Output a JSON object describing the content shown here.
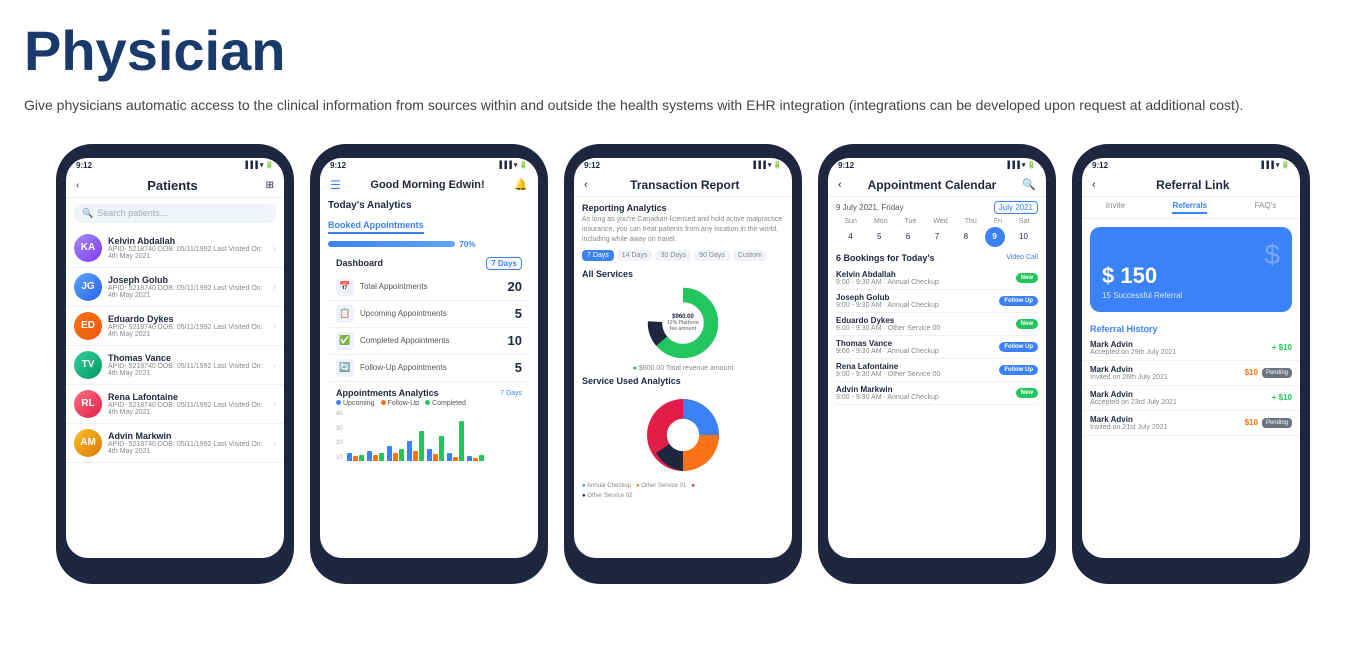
{
  "heading": "Physician",
  "subtitle": "Give physicians automatic access to the clinical information from sources within and outside the health systems with EHR integration (integrations can be developed upon request at additional cost).",
  "phones": {
    "phone1": {
      "status_time": "9:12",
      "title": "Patients",
      "search_placeholder": "Search patients...",
      "patients": [
        {
          "name": "Kelvin Abdallah",
          "details": "APID- 5218740   DOB: 05/11/1992   Last Visited On: 4th May 2021",
          "av": "av1",
          "initials": "KA"
        },
        {
          "name": "Joseph Golub",
          "details": "APID- 5218740   DOB: 05/11/1992   Last Visited On: 4th May 2021",
          "av": "av2",
          "initials": "JG"
        },
        {
          "name": "Eduardo Dykes",
          "details": "APID- 5218740   DOB: 05/11/1992   Last Visited On: 4th May 2021",
          "av": "av3",
          "initials": "ED"
        },
        {
          "name": "Thomas Vance",
          "details": "APID- 5218740   DOB: 05/11/1992   Last Visited On: 4th May 2021",
          "av": "av4",
          "initials": "TV"
        },
        {
          "name": "Rena Lafontaine",
          "details": "APID- 5218740   DOB: 05/11/1992   Last Visited On: 4th May 2021",
          "av": "av5",
          "initials": "RL"
        },
        {
          "name": "Advin Markwin",
          "details": "APID- 5218740   DOB: 05/11/1992   Last Visited On: 4th May 2021",
          "av": "av6",
          "initials": "AM"
        }
      ]
    },
    "phone2": {
      "status_time": "9:12",
      "greeting": "Good Morning Edwin!",
      "analytics_title": "Today's Analytics",
      "booked_tab": "Booked Appointments",
      "booked_pct": "70%",
      "dashboard_title": "Dashboard",
      "days_label": "7 Days",
      "stats": [
        {
          "label": "Total Appointments",
          "value": "20",
          "icon": "📅"
        },
        {
          "label": "Upcoming Appointments",
          "value": "5",
          "icon": "📋"
        },
        {
          "label": "Completed Appointments",
          "value": "10",
          "icon": "✅"
        },
        {
          "label": "Follow-Up Appointments",
          "value": "5",
          "icon": "🔄"
        }
      ],
      "appointments_analytics_title": "Appointments Analytics",
      "appointments_days": "7 Days",
      "legend": [
        "Upcoming",
        "Follow-Up",
        "Completed"
      ]
    },
    "phone3": {
      "status_time": "9:12",
      "title": "Transaction Report",
      "reporting_title": "Reporting Analytics",
      "reporting_desc": "As long as you're Canadian-licensed and hold active malpractice insurance, you can treat patients from any location in the world, including while away on travel.",
      "filter_tabs": [
        "7 Days",
        "14 Days",
        "30 Days",
        "90 Days",
        "Custom"
      ],
      "active_filter": "7 Days",
      "all_services_title": "All Services",
      "service_analytics_title": "Service Used Analytics",
      "donut_values": [
        {
          "label": "$960.00\n12% Platform fee amount",
          "pct": 12,
          "color": "#1e2640"
        },
        {
          "label": "$600.00\nTotal revenue amount",
          "pct": 88,
          "color": "#22c55e"
        }
      ]
    },
    "phone4": {
      "status_time": "9:12",
      "title": "Appointment Calendar",
      "date_label": "9 July 2021, Friday",
      "month_label": "July 2021",
      "day_headers": [
        "Sun",
        "Mon",
        "Tue",
        "Wed",
        "Thu",
        "Fri",
        "Sat"
      ],
      "days": [
        "4",
        "5",
        "6",
        "7",
        "8",
        "9",
        "10"
      ],
      "active_day": "9",
      "bookings_title": "6 Bookings for Today's",
      "video_call": "Video Call",
      "bookings": [
        {
          "name": "Kelvin Abdallah",
          "time": "9:00 - 9:30 AM · Annual Checkup",
          "badge": "new",
          "badge_label": "New"
        },
        {
          "name": "Joseph Golub",
          "time": "9:00 - 9:30 AM · Annual Checkup",
          "badge": "followup",
          "badge_label": "Follow Up"
        },
        {
          "name": "Eduardo Dykes",
          "time": "9:00 - 9:30 AM · Other Service 00",
          "badge": "new",
          "badge_label": "New"
        },
        {
          "name": "Thomas Vance",
          "time": "9:00 - 9:30 AM · Annual Checkup",
          "badge": "followup",
          "badge_label": "Follow Up"
        },
        {
          "name": "Rena Lafontaine",
          "time": "9:00 - 9:30 AM · Other Service 00",
          "badge": "followup",
          "badge_label": "Follow Up"
        },
        {
          "name": "Advin Markwin",
          "time": "9:00 - 9:30 AM · Annual Checkup",
          "badge": "new",
          "badge_label": "New"
        }
      ]
    },
    "phone5": {
      "status_time": "9:12",
      "title": "Referral Link",
      "tabs": [
        "Invite",
        "Referrals",
        "FAQ's"
      ],
      "active_tab": "Referrals",
      "banner_amount": "$ 150",
      "banner_subtitle": "15 Successful Referral",
      "dollar_icon": "$",
      "referral_history_title": "Referral History",
      "referrals": [
        {
          "name": "Mark Advin",
          "date": "Accepted on 29th July 2021",
          "amount": "+ $10",
          "type": "positive"
        },
        {
          "name": "Mark Advin",
          "date": "Invited on 26th July 2021",
          "amount": "$10",
          "type": "pending",
          "status": "Pending"
        },
        {
          "name": "Mark Advin",
          "date": "Accepted on 23rd July 2021",
          "amount": "+ $10",
          "type": "positive"
        },
        {
          "name": "Mark Advin",
          "date": "Invited on 21st July 2021",
          "amount": "$10",
          "type": "pending",
          "status": "Pending"
        }
      ]
    }
  }
}
